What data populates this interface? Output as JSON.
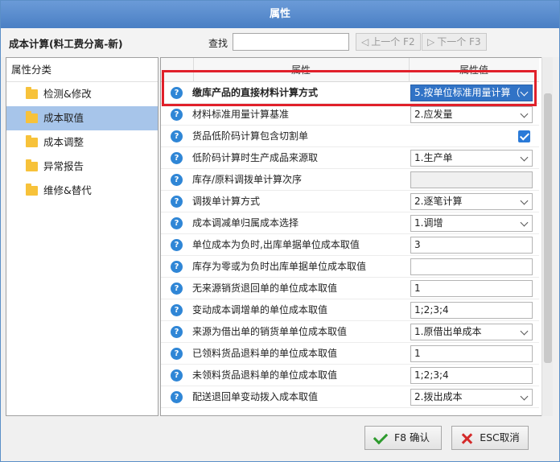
{
  "window": {
    "title": "属性"
  },
  "header": {
    "category_title": "成本计算(料工费分离-新)",
    "find_label": "查找",
    "find_value": "",
    "prev_label": "上一个 F2",
    "next_label": "下一个 F3"
  },
  "left_panel": {
    "heading": "属性分类",
    "items": [
      {
        "label": "检测&修改",
        "selected": false
      },
      {
        "label": "成本取值",
        "selected": true
      },
      {
        "label": "成本调整",
        "selected": false
      },
      {
        "label": "异常报告",
        "selected": false
      },
      {
        "label": "维修&替代",
        "selected": false
      }
    ]
  },
  "grid": {
    "col_property": "属性",
    "col_value": "属性值",
    "rows": [
      {
        "label": "缴库产品的直接材料计算方式",
        "value": "5.按单位标准用量计算（",
        "kind": "combo",
        "bold": true,
        "highlight": true
      },
      {
        "label": "材料标准用量计算基准",
        "value": "2.应发量",
        "kind": "combo"
      },
      {
        "label": "货品低阶码计算包含切割单",
        "value": "",
        "kind": "checkbox",
        "checked": true
      },
      {
        "label": "低阶码计算时生产成品来源取",
        "value": "1.生产单",
        "kind": "combo"
      },
      {
        "label": "库存/原料调拨单计算次序",
        "value": "",
        "kind": "empty"
      },
      {
        "label": "调拨单计算方式",
        "value": "2.逐笔计算",
        "kind": "combo"
      },
      {
        "label": "成本调减单归属成本选择",
        "value": "1.调增",
        "kind": "combo"
      },
      {
        "label": "单位成本为负时,出库单据单位成本取值",
        "value": "3",
        "kind": "text"
      },
      {
        "label": "库存为零或为负时出库单据单位成本取值",
        "value": "",
        "kind": "text"
      },
      {
        "label": "无来源销货退回单的单位成本取值",
        "value": "1",
        "kind": "text"
      },
      {
        "label": "变动成本调增单的单位成本取值",
        "value": "1;2;3;4",
        "kind": "text"
      },
      {
        "label": "来源为借出单的销货单单位成本取值",
        "value": "1.原借出单成本",
        "kind": "combo"
      },
      {
        "label": "已领料货品退料单的单位成本取值",
        "value": "1",
        "kind": "text"
      },
      {
        "label": "未领料货品退料单的单位成本取值",
        "value": "1;2;3;4",
        "kind": "text"
      },
      {
        "label": "配送退回单变动拨入成本取值",
        "value": "2.拨出成本",
        "kind": "combo"
      }
    ]
  },
  "footer": {
    "ok_label": "F8 确认",
    "cancel_label": "ESC取消"
  }
}
